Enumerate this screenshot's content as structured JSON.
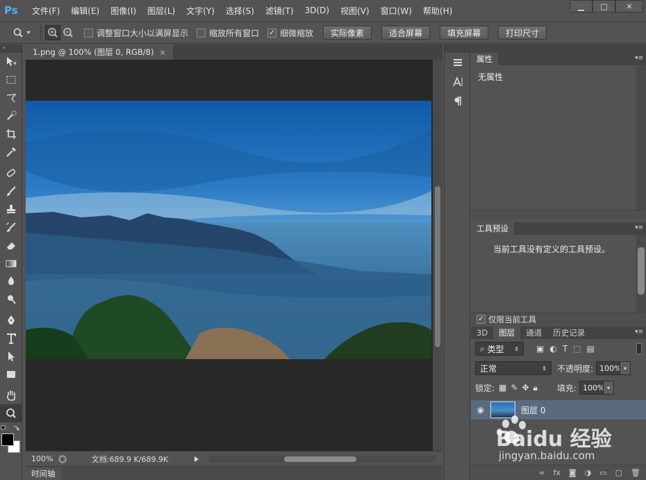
{
  "app": {
    "logo": "Ps"
  },
  "menu": [
    "文件(F)",
    "编辑(E)",
    "图像(I)",
    "图层(L)",
    "文字(Y)",
    "选择(S)",
    "滤镜(T)",
    "3D(D)",
    "视图(V)",
    "窗口(W)",
    "帮助(H)"
  ],
  "window_controls": {
    "minimize": "▁",
    "maximize": "□",
    "close": "✕"
  },
  "options": {
    "resize_windows_label": "调整窗口大小以满屏显示",
    "resize_windows_checked": false,
    "zoom_all_label": "缩放所有窗口",
    "zoom_all_checked": false,
    "scrubby_label": "细微缩放",
    "scrubby_checked": true,
    "btn_actual_pixels": "实际像素",
    "btn_fit_screen": "适合屏幕",
    "btn_fill_screen": "填充屏幕",
    "btn_print_size": "打印尺寸"
  },
  "document": {
    "tab_title": "1.png @ 100% (图层 0, RGB/8)",
    "tab_close": "×",
    "zoom": "100%",
    "doc_info": "文档:689.9 K/689.9K"
  },
  "timeline": {
    "label": "时间轴"
  },
  "properties": {
    "tab": "属性",
    "content": "无属性"
  },
  "tool_presets": {
    "tab": "工具预设",
    "message": "当前工具没有定义的工具预设。",
    "current_tool_only_label": "仅限当前工具",
    "current_tool_only_checked": true
  },
  "layers": {
    "tabs": [
      "3D",
      "图层",
      "通道",
      "历史记录"
    ],
    "active_tab": "图层",
    "filter_label": "类型",
    "blend_mode": "正常",
    "opacity_label": "不透明度:",
    "opacity": "100%",
    "lock_label": "锁定:",
    "fill_label": "填充:",
    "fill": "100%",
    "items": [
      {
        "name": "图层 0",
        "visible": true
      }
    ]
  },
  "watermark": {
    "text": "jingyan.baidu.com",
    "brand": "Baidu 经验"
  },
  "colors": {
    "accent_ps": "#4fb3f6",
    "layer_selected": "#596b7e",
    "foreground": "#000000",
    "background": "#ffffff"
  }
}
